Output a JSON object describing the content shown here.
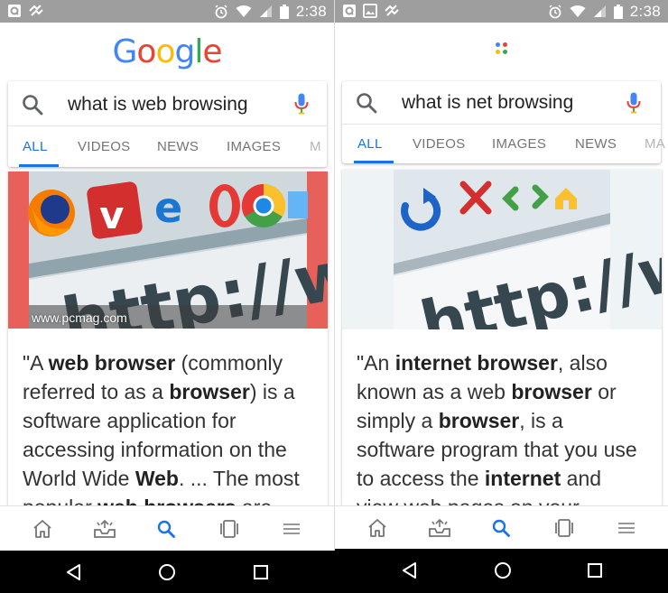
{
  "status_bar": {
    "time": "2:38"
  },
  "left": {
    "logo_text": "Google",
    "search": {
      "query": "what is web browsing"
    },
    "tabs": [
      {
        "label": "ALL",
        "active": true
      },
      {
        "label": "VIDEOS"
      },
      {
        "label": "NEWS"
      },
      {
        "label": "IMAGES"
      },
      {
        "label": "M"
      }
    ],
    "image_caption": "www.pcmag.com",
    "image_text": "http://ww",
    "snippet_parts": [
      {
        "t": "\"A "
      },
      {
        "t": "web browser",
        "b": true
      },
      {
        "t": " (commonly referred to as a "
      },
      {
        "t": "browser",
        "b": true
      },
      {
        "t": ") is a software application for accessing information on the World Wide "
      },
      {
        "t": "Web",
        "b": true
      },
      {
        "t": ". ... The most popular "
      },
      {
        "t": "web browsers",
        "b": true
      },
      {
        "t": " are"
      }
    ]
  },
  "right": {
    "search": {
      "query": "what is net browsing"
    },
    "tabs": [
      {
        "label": "ALL",
        "active": true
      },
      {
        "label": "VIDEOS"
      },
      {
        "label": "IMAGES"
      },
      {
        "label": "NEWS"
      },
      {
        "label": "MA"
      }
    ],
    "image_text": "http://ww",
    "snippet_parts": [
      {
        "t": "\"An "
      },
      {
        "t": "internet browser",
        "b": true
      },
      {
        "t": ", also known as a web "
      },
      {
        "t": "browser",
        "b": true
      },
      {
        "t": " or simply a "
      },
      {
        "t": "browser",
        "b": true
      },
      {
        "t": ", is a software program that you use to access the "
      },
      {
        "t": "internet",
        "b": true
      },
      {
        "t": " and view web pages on your"
      }
    ]
  },
  "bottom_nav": [
    "home-icon",
    "updates-icon",
    "search-icon",
    "tabs-icon",
    "menu-icon"
  ],
  "colors": {
    "google_blue": "#4285f4",
    "google_red": "#ea4335",
    "google_yellow": "#fbbc05",
    "google_green": "#34a853",
    "active_tab": "#1a73e8",
    "status_bar": "#9e9e9e"
  }
}
